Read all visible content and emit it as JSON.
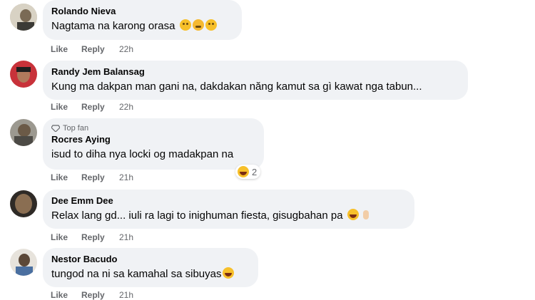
{
  "comments": [
    {
      "name": "Rolando Nieva",
      "text": "Nagtama na karong orasa",
      "emojis": [
        "flushed-face",
        "sweat-face",
        "flushed-face"
      ],
      "like": "Like",
      "reply": "Reply",
      "time": "22h"
    },
    {
      "name": "Randy Jem Balansag",
      "text": "Kung ma dakpan man gani na, dakdakan năng kamut sa gì kawat nga tabun...",
      "like": "Like",
      "reply": "Reply",
      "time": "22h"
    },
    {
      "badge": "Top fan",
      "name": "Rocres Aying",
      "text": "isud to diha nya locki og madakpan na",
      "reaction_count": "2",
      "like": "Like",
      "reply": "Reply",
      "time": "21h"
    },
    {
      "name": "Dee Emm Dee",
      "text": "Relax lang gd... iuli ra lagi to inighuman fiesta, gisugbahan pa",
      "emojis": [
        "rolling-laughing-face",
        "victory-hand"
      ],
      "like": "Like",
      "reply": "Reply",
      "time": "21h"
    },
    {
      "name": "Nestor Bacudo",
      "text": "tungod na ni sa kamahal sa sibuyas",
      "emojis": [
        "rolling-laughing-face"
      ],
      "like": "Like",
      "reply": "Reply",
      "time": "21h"
    }
  ],
  "colors": {
    "bubble": "#f0f2f5",
    "meta": "#65676b",
    "text": "#050505"
  }
}
